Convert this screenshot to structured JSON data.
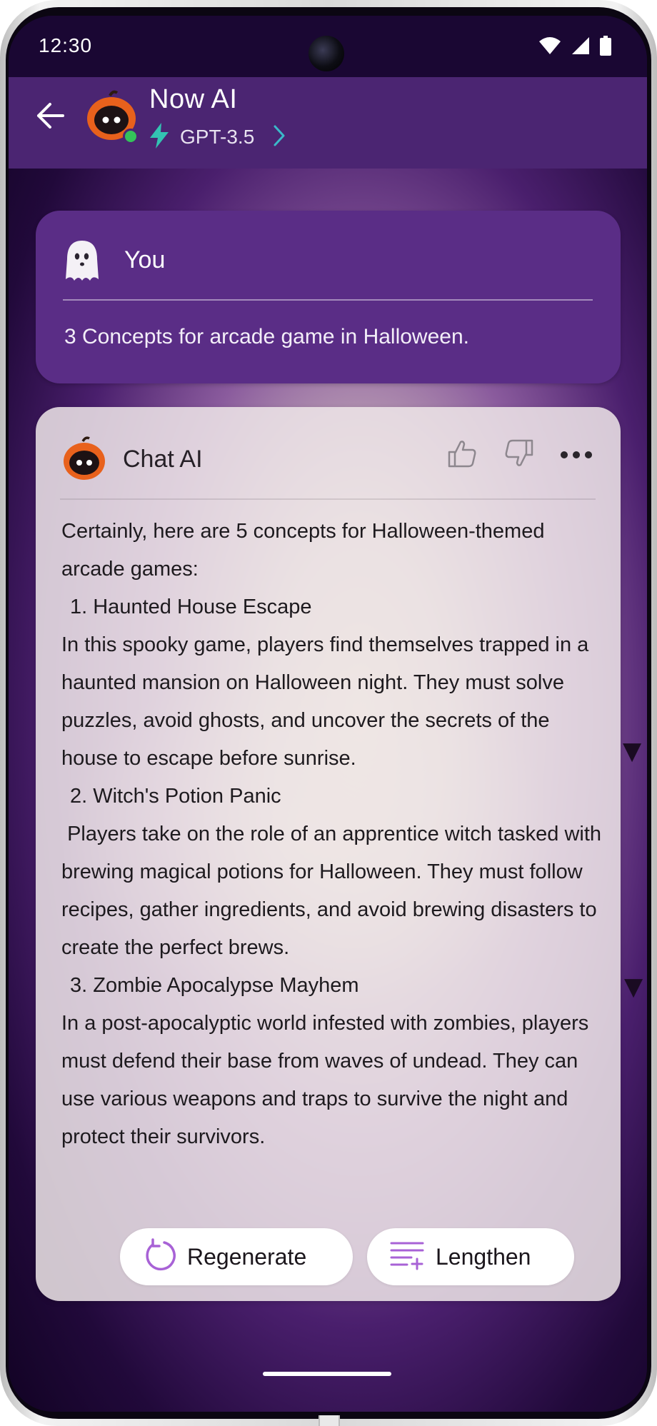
{
  "status_bar": {
    "time": "12:30",
    "icons": [
      "wifi-icon",
      "cellular-signal-icon",
      "battery-icon"
    ]
  },
  "header": {
    "back_icon": "arrow-left-icon",
    "title": "Now AI",
    "model": "GPT-3.5",
    "model_icon": "lightning-bolt-icon",
    "online_status_color": "#34c25a"
  },
  "user_message": {
    "name": "You",
    "avatar_icon": "ghost-icon",
    "text": "3 Concepts for arcade game in Halloween."
  },
  "ai_message": {
    "name": "Chat AI",
    "avatar_icon": "pumpkin-bot-icon",
    "actions": [
      "thumbs-up-icon",
      "thumbs-down-icon",
      "more-options-icon"
    ],
    "lines": [
      "Certainly, here are 5 concepts for Halloween-themed arcade games:",
      "1. Haunted House Escape",
      "In this spooky game, players find themselves trapped in a haunted mansion on Halloween night. They must solve puzzles, avoid ghosts, and uncover the secrets of the house to escape before sunrise.",
      "2. Witch's Potion Panic",
      " Players take on the role of an apprentice witch tasked with brewing magical potions for Halloween. They must follow recipes, gather ingredients, and avoid brewing disasters to create the perfect brews.",
      "3. Zombie Apocalypse Mayhem",
      "In a post-apocalyptic world infested with zombies, players must defend their base from waves of undead. They can use various weapons and traps to survive the night and protect their survivors."
    ],
    "regenerate_label": "Regenerate",
    "lengthen_label": "Lengthen"
  },
  "colors": {
    "header_bg": "#4b2572",
    "user_card_bg": "#5a2d86",
    "accent_purple": "#a862d6",
    "teal_chevron": "#3bb9c9"
  }
}
